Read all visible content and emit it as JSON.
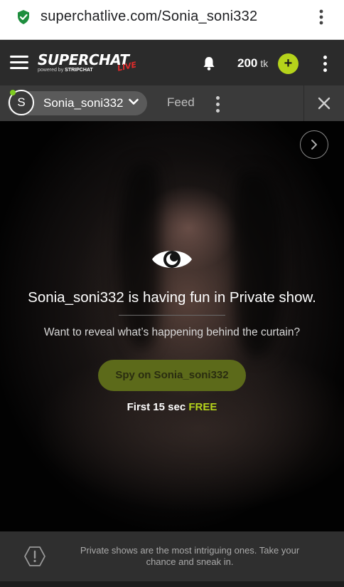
{
  "browser": {
    "url": "superchatlive.com/Sonia_soni332",
    "secure_icon": "shield-check-icon",
    "menu_icon": "vertical-dots-icon"
  },
  "header": {
    "logo_text": "SUPERCHAT",
    "logo_live": "LIVE",
    "logo_powered": "powered by",
    "logo_powered_brand": "STRIPCHAT",
    "menu_icon": "hamburger-icon",
    "notification_icon": "bell-icon",
    "token_count": "200",
    "token_unit": "tk",
    "add_tokens_label": "+",
    "more_icon": "vertical-dots-icon"
  },
  "tabs": {
    "avatar_letter": "S",
    "username": "Sonia_soni332",
    "feed_label": "Feed",
    "close_icon": "close-icon"
  },
  "video": {
    "headline": "Sonia_soni332 is having fun in Private show.",
    "subline": "Want to reveal what’s happening behind the curtain?",
    "spy_button": "Spy on Sonia_soni332",
    "free_prefix": "First 15 sec",
    "free_highlight": "FREE",
    "eye_icon": "eye-icon",
    "next_icon": "chevron-right-icon"
  },
  "banner": {
    "text": "Private shows are the most intriguing ones. Take your chance and sneak in.",
    "icon": "warning-hexagon-icon"
  },
  "colors": {
    "accent": "#b5d31b",
    "header_bg": "#2b2b2b",
    "tabbar_bg": "#3a3a3a",
    "online": "#7ecb20",
    "live_red": "#e02b2b"
  }
}
